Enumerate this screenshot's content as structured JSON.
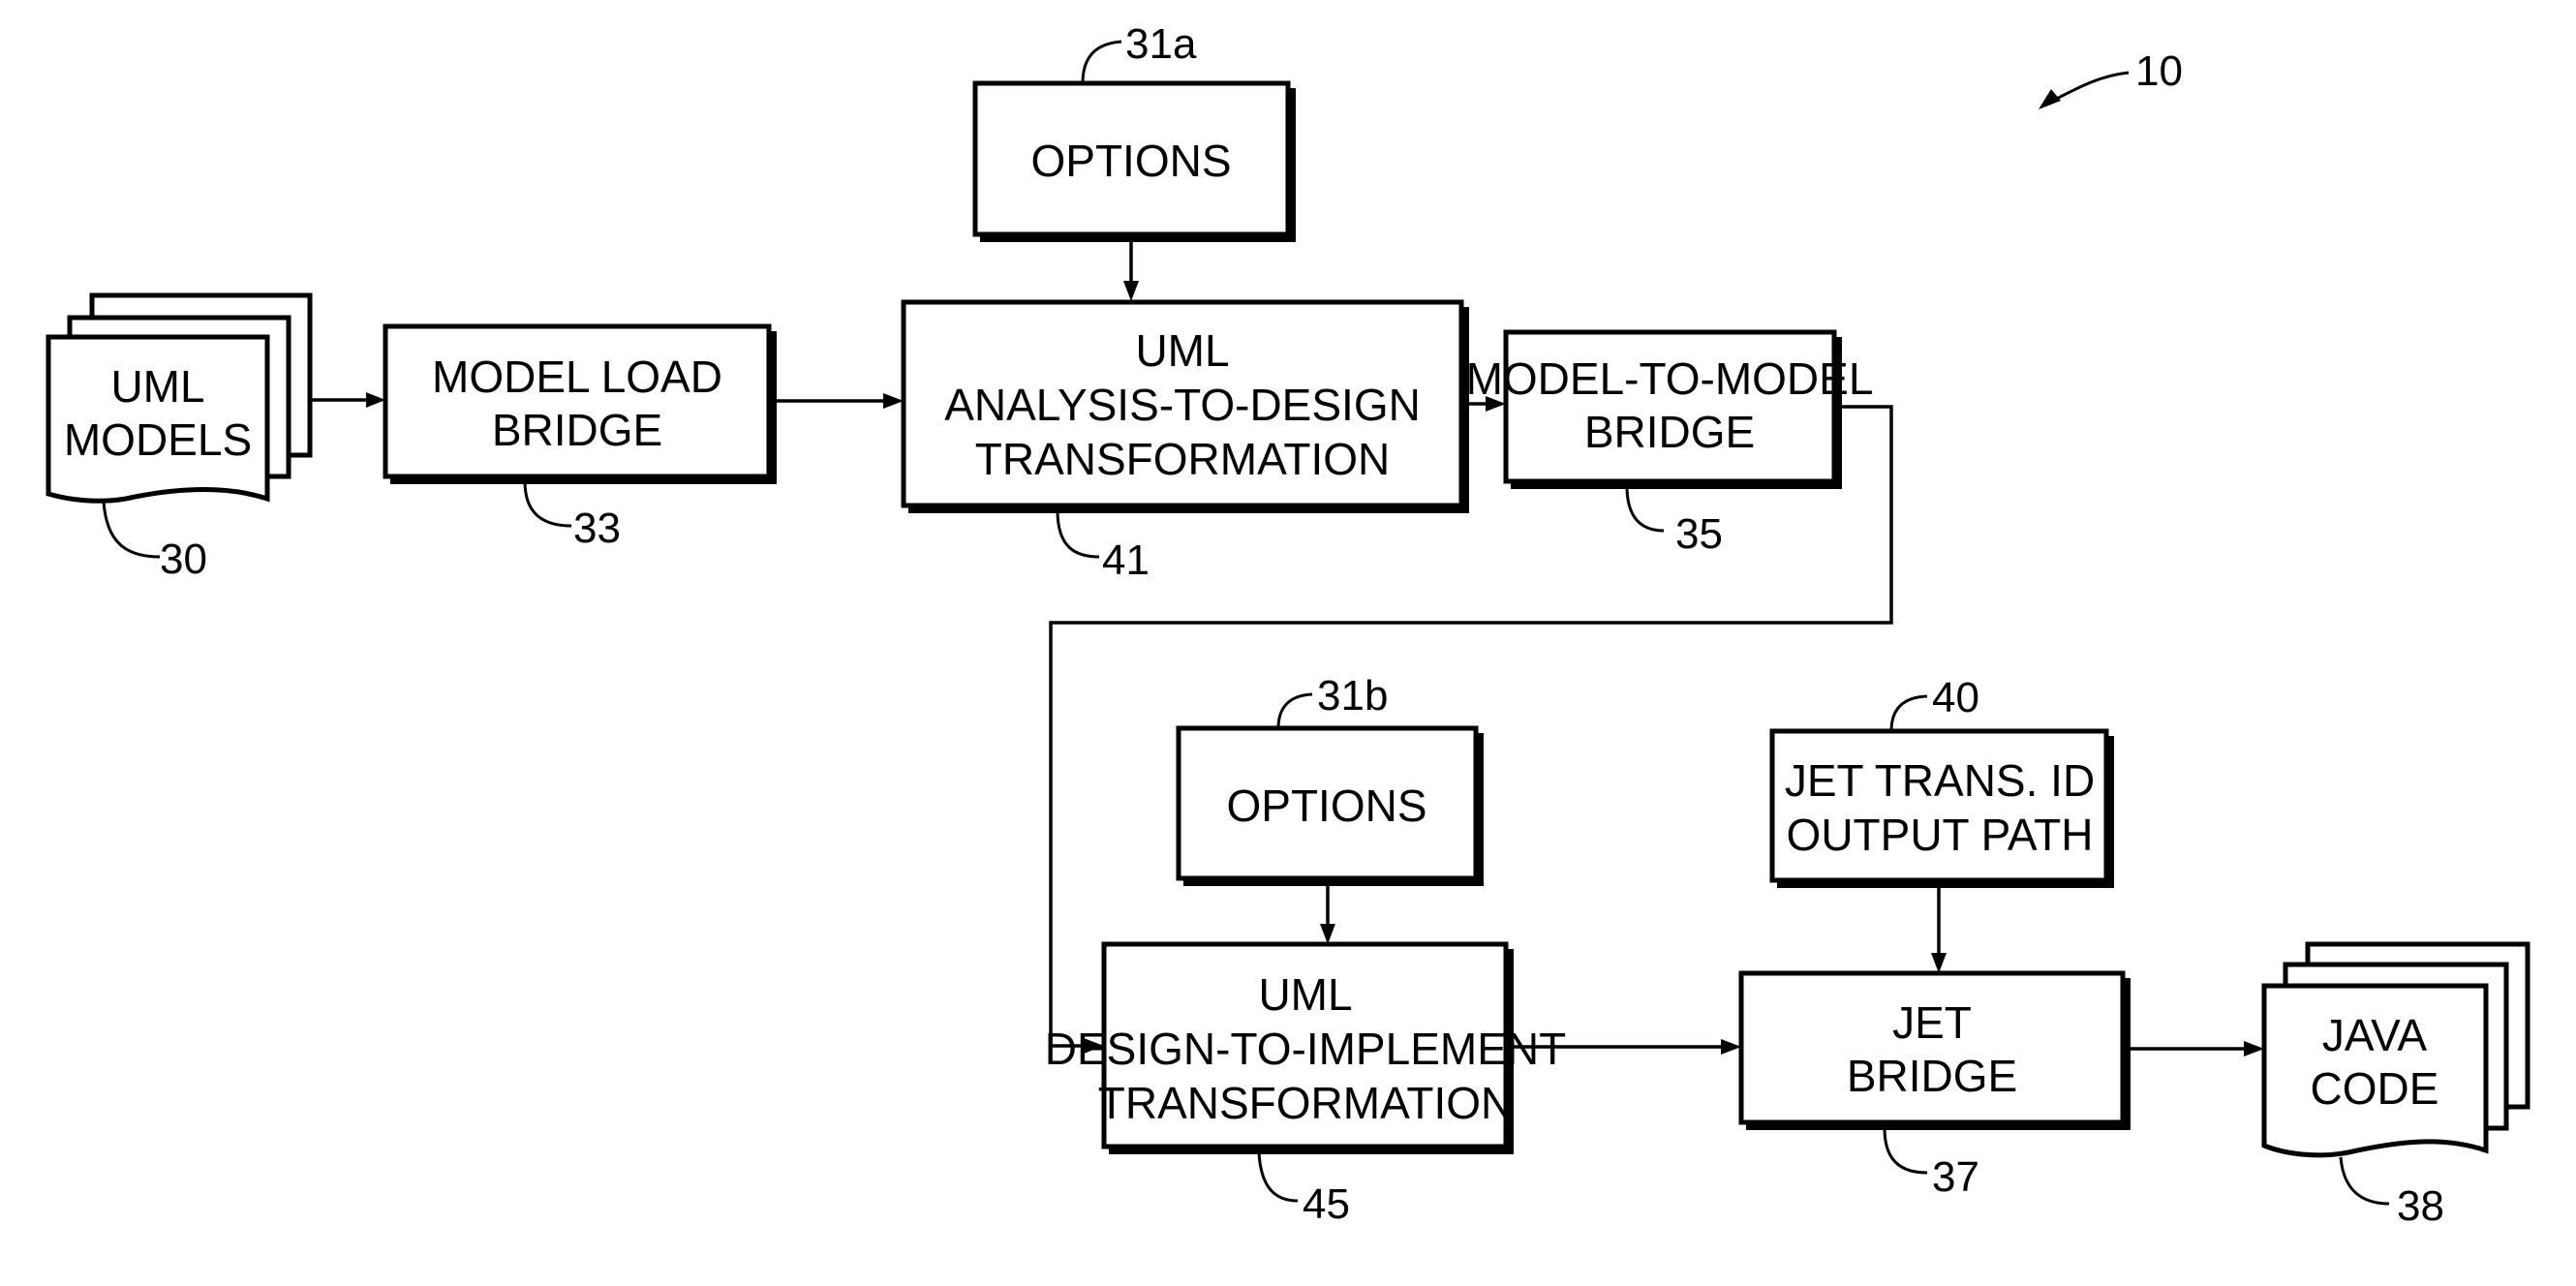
{
  "figure": {
    "reference": "10"
  },
  "nodes": {
    "uml_models": {
      "lines": [
        "UML",
        "MODELS"
      ],
      "ref": "30",
      "kind": "document-stack"
    },
    "model_load_bridge": {
      "lines": [
        "MODEL LOAD",
        "BRIDGE"
      ],
      "ref": "33",
      "kind": "process"
    },
    "options_a": {
      "lines": [
        "OPTIONS"
      ],
      "ref": "31a",
      "kind": "process"
    },
    "analysis_to_design": {
      "lines": [
        "UML",
        "ANALYSIS-TO-DESIGN",
        "TRANSFORMATION"
      ],
      "ref": "41",
      "kind": "process"
    },
    "model_to_model_bridge": {
      "lines": [
        "MODEL-TO-MODEL",
        "BRIDGE"
      ],
      "ref": "35",
      "kind": "process"
    },
    "options_b": {
      "lines": [
        "OPTIONS"
      ],
      "ref": "31b",
      "kind": "process"
    },
    "jet_trans_id": {
      "lines": [
        "JET TRANS. ID",
        "OUTPUT PATH"
      ],
      "ref": "40",
      "kind": "process"
    },
    "design_to_implement": {
      "lines": [
        "UML",
        "DESIGN-TO-IMPLEMENT",
        "TRANSFORMATION"
      ],
      "ref": "45",
      "kind": "process"
    },
    "jet_bridge": {
      "lines": [
        "JET",
        "BRIDGE"
      ],
      "ref": "37",
      "kind": "process"
    },
    "java_code": {
      "lines": [
        "JAVA",
        "CODE"
      ],
      "ref": "38",
      "kind": "document-stack"
    }
  },
  "edges": [
    {
      "from": "uml_models",
      "to": "model_load_bridge"
    },
    {
      "from": "model_load_bridge",
      "to": "analysis_to_design"
    },
    {
      "from": "options_a",
      "to": "analysis_to_design"
    },
    {
      "from": "analysis_to_design",
      "to": "model_to_model_bridge"
    },
    {
      "from": "model_to_model_bridge",
      "to": "design_to_implement"
    },
    {
      "from": "options_b",
      "to": "design_to_implement"
    },
    {
      "from": "design_to_implement",
      "to": "jet_bridge"
    },
    {
      "from": "jet_trans_id",
      "to": "jet_bridge"
    },
    {
      "from": "jet_bridge",
      "to": "java_code"
    }
  ]
}
